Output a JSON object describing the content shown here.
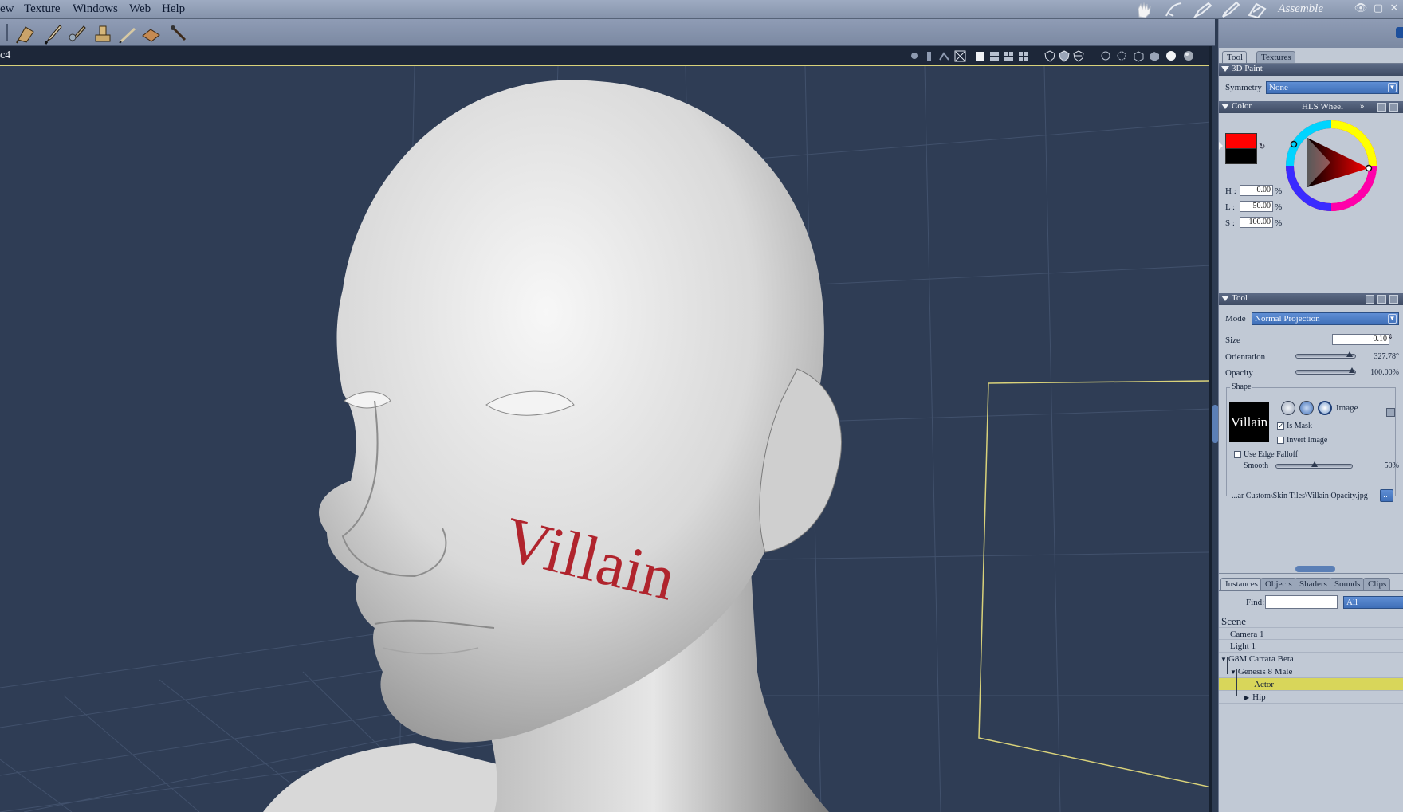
{
  "menubar": {
    "items": [
      "ew",
      "Texture",
      "Windows",
      "Web",
      "Help"
    ],
    "room_label": "Assemble"
  },
  "viewport": {
    "title": "c4",
    "cheek_text": "Villain"
  },
  "right_panel": {
    "top_tabs": [
      "Tool",
      "Textures"
    ],
    "paint": {
      "header": "3D Paint",
      "symmetry_label": "Symmetry",
      "symmetry_value": "None"
    },
    "color": {
      "header": "Color",
      "mode": "HLS Wheel",
      "swatch_fg": "#ff0000",
      "swatch_bg": "#000000",
      "h_label": "H :",
      "h_value": "0.00",
      "l_label": "L :",
      "l_value": "50.00",
      "s_label": "S :",
      "s_value": "100.00",
      "pct": "%"
    },
    "tool": {
      "header": "Tool",
      "mode_label": "Mode",
      "mode_value": "Normal Projection",
      "size_label": "Size",
      "size_value": "0.10",
      "orientation_label": "Orientation",
      "orientation_value": "327.78°",
      "orientation_fraction": 0.91,
      "opacity_label": "Opacity",
      "opacity_value": "100.00%",
      "opacity_fraction": 1.0
    },
    "shape": {
      "legend": "Shape",
      "thumb_text": "Villain",
      "image_label": "Image",
      "is_mask_label": "Is Mask",
      "is_mask_checked": true,
      "invert_label": "Invert Image",
      "invert_checked": false,
      "edge_falloff_label": "Use Edge Falloff",
      "edge_falloff_checked": false,
      "smooth_label": "Smooth",
      "smooth_value": "50%",
      "smooth_fraction": 0.5,
      "file_path": "...ar Custom\\Skin Tiles\\Villain Opacity.jpg"
    },
    "bottom_tabs": [
      "Instances",
      "Objects",
      "Shaders",
      "Sounds",
      "Clips"
    ],
    "find_label": "Find:",
    "find_filter": "All",
    "scene": {
      "header": "Scene",
      "rows": [
        "Camera 1",
        "Light 1",
        "G8M Carrara Beta",
        "Genesis 8 Male",
        "Actor",
        "Hip"
      ]
    }
  },
  "colors": {
    "accent": "#3f6fb8",
    "selection": "#d8d65a",
    "paint": "#b0242d"
  }
}
